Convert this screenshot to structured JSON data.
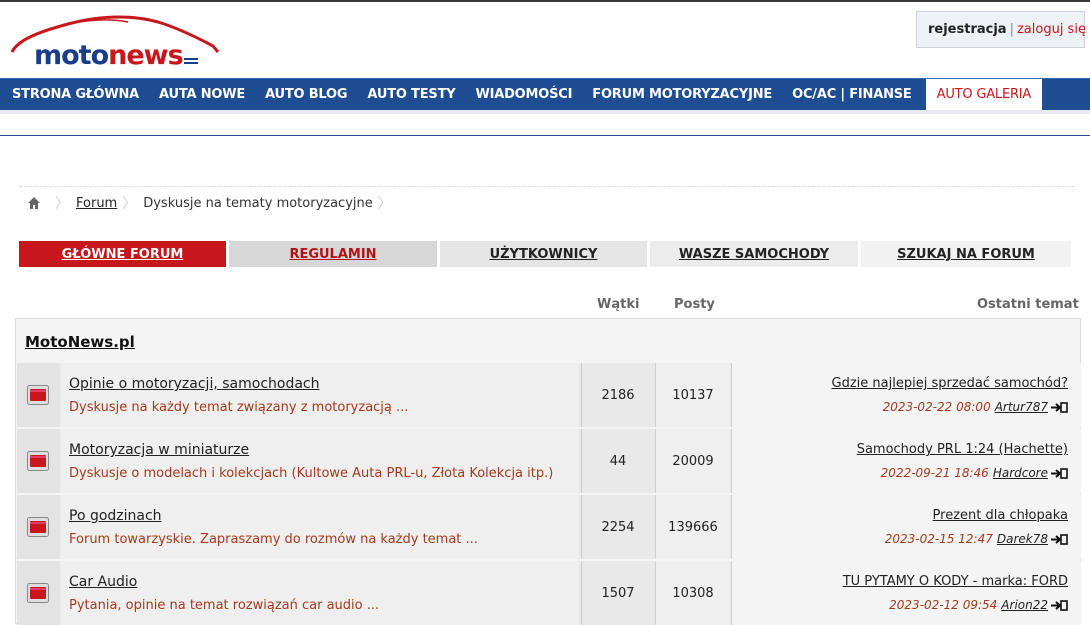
{
  "brand": {
    "logo_main": "moto",
    "logo_accent": "news",
    "colors": {
      "blue": "#1e4d93",
      "red": "#c8171c"
    }
  },
  "auth": {
    "register": "rejestracja",
    "separator": "|",
    "login": "zaloguj się"
  },
  "nav": {
    "items": [
      {
        "label": "STRONA GŁÓWNA"
      },
      {
        "label": "AUTA NOWE"
      },
      {
        "label": "AUTO BLOG"
      },
      {
        "label": "AUTO TESTY"
      },
      {
        "label": "WIADOMOŚCI"
      },
      {
        "label": "FORUM MOTORYZACYJNE"
      },
      {
        "label": "OC/AC | FINANSE"
      },
      {
        "label": "AUTO GALERIA",
        "active": true
      }
    ]
  },
  "breadcrumb": {
    "home_icon": "home-icon",
    "forum": "Forum",
    "current": "Dyskusje na tematy motoryzacyjne"
  },
  "tabs": [
    {
      "label": "GŁÓWNE FORUM",
      "active": true
    },
    {
      "label": "REGULAMIN"
    },
    {
      "label": "UŻYTKOWNICY"
    },
    {
      "label": "WASZE SAMOCHODY"
    },
    {
      "label": "SZUKAJ NA FORUM"
    }
  ],
  "columns": {
    "threads": "Wątki",
    "posts": "Posty",
    "last": "Ostatni temat"
  },
  "category": {
    "title": "MotoNews.pl"
  },
  "forums": [
    {
      "title": "Opinie o motoryzacji, samochodach",
      "desc": "Dyskusje na każdy temat związany z motoryzacją ...",
      "threads": "2186",
      "posts": "10137",
      "last_title": "Gdzie najlepiej sprzedać samochód?",
      "last_date": "2023-02-22 08:00",
      "last_user": "Artur787"
    },
    {
      "title": "Motoryzacja w miniaturze",
      "desc": "Dyskusje o modelach i kolekcjach (Kultowe Auta PRL-u, Złota Kolekcja itp.)",
      "threads": "44",
      "posts": "20009",
      "last_title": "Samochody PRL 1:24 (Hachette)",
      "last_date": "2022-09-21 18:46",
      "last_user": "Hardcore"
    },
    {
      "title": "Po godzinach",
      "desc": "Forum towarzyskie. Zapraszamy do rozmów na każdy temat ...",
      "threads": "2254",
      "posts": "139666",
      "last_title": "Prezent dla chłopaka",
      "last_date": "2023-02-15 12:47",
      "last_user": "Darek78"
    },
    {
      "title": "Car Audio",
      "desc": "Pytania, opinie na temat rozwiązań car audio ...",
      "threads": "1507",
      "posts": "10308",
      "last_title": "TU PYTAMY O KODY - marka: FORD",
      "last_date": "2023-02-12 09:54",
      "last_user": "Arion22"
    }
  ]
}
